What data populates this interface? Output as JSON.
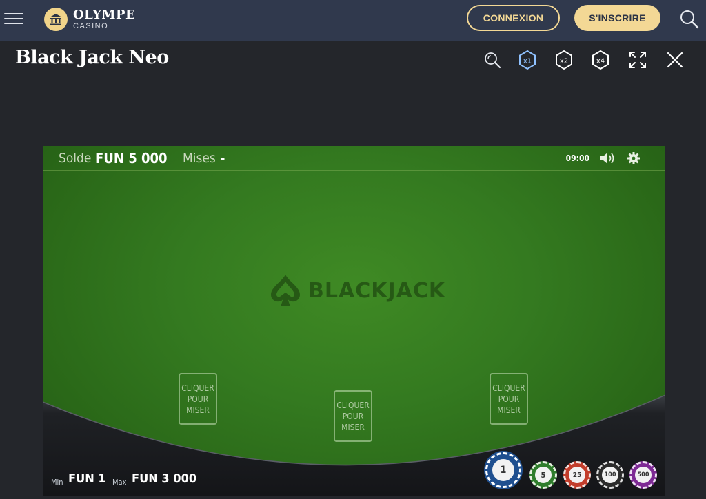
{
  "header": {
    "logo_name": "OLYMPE",
    "logo_sub": "CASINO",
    "login_label": "CONNEXION",
    "signup_label": "S'INSCRIRE",
    "colors": {
      "bar": "#30394d",
      "accent": "#f3d895"
    }
  },
  "game": {
    "title": "Black Jack Neo",
    "tools": [
      {
        "icon": "zoom-icon"
      },
      {
        "icon": "speed-x1-icon",
        "label": "x1",
        "active": true
      },
      {
        "icon": "speed-x2-icon",
        "label": "x2"
      },
      {
        "icon": "speed-x4-icon",
        "label": "x4"
      },
      {
        "icon": "fullscreen-icon"
      },
      {
        "icon": "close-icon"
      }
    ]
  },
  "table": {
    "balance_label": "Solde",
    "balance_value": "FUN 5 000",
    "bets_label": "Mises",
    "bets_value": "-",
    "time": "09:00",
    "brand": "BLACKJACK",
    "bet_spots": [
      {
        "text": "CLIQUER\nPOUR\nMISER"
      },
      {
        "text": "CLIQUER\nPOUR\nMISER"
      },
      {
        "text": "CLIQUER\nPOUR\nMISER"
      }
    ],
    "min_label": "Min",
    "min_value": "FUN 1",
    "max_label": "Max",
    "max_value": "FUN 3 000",
    "chips": [
      {
        "value": "1",
        "color": "#1f4f8f",
        "selected": true
      },
      {
        "value": "5",
        "color": "#2f7d2c"
      },
      {
        "value": "25",
        "color": "#c23d2b"
      },
      {
        "value": "100",
        "color": "#2b2b2b"
      },
      {
        "value": "500",
        "color": "#7d2a94"
      }
    ]
  }
}
